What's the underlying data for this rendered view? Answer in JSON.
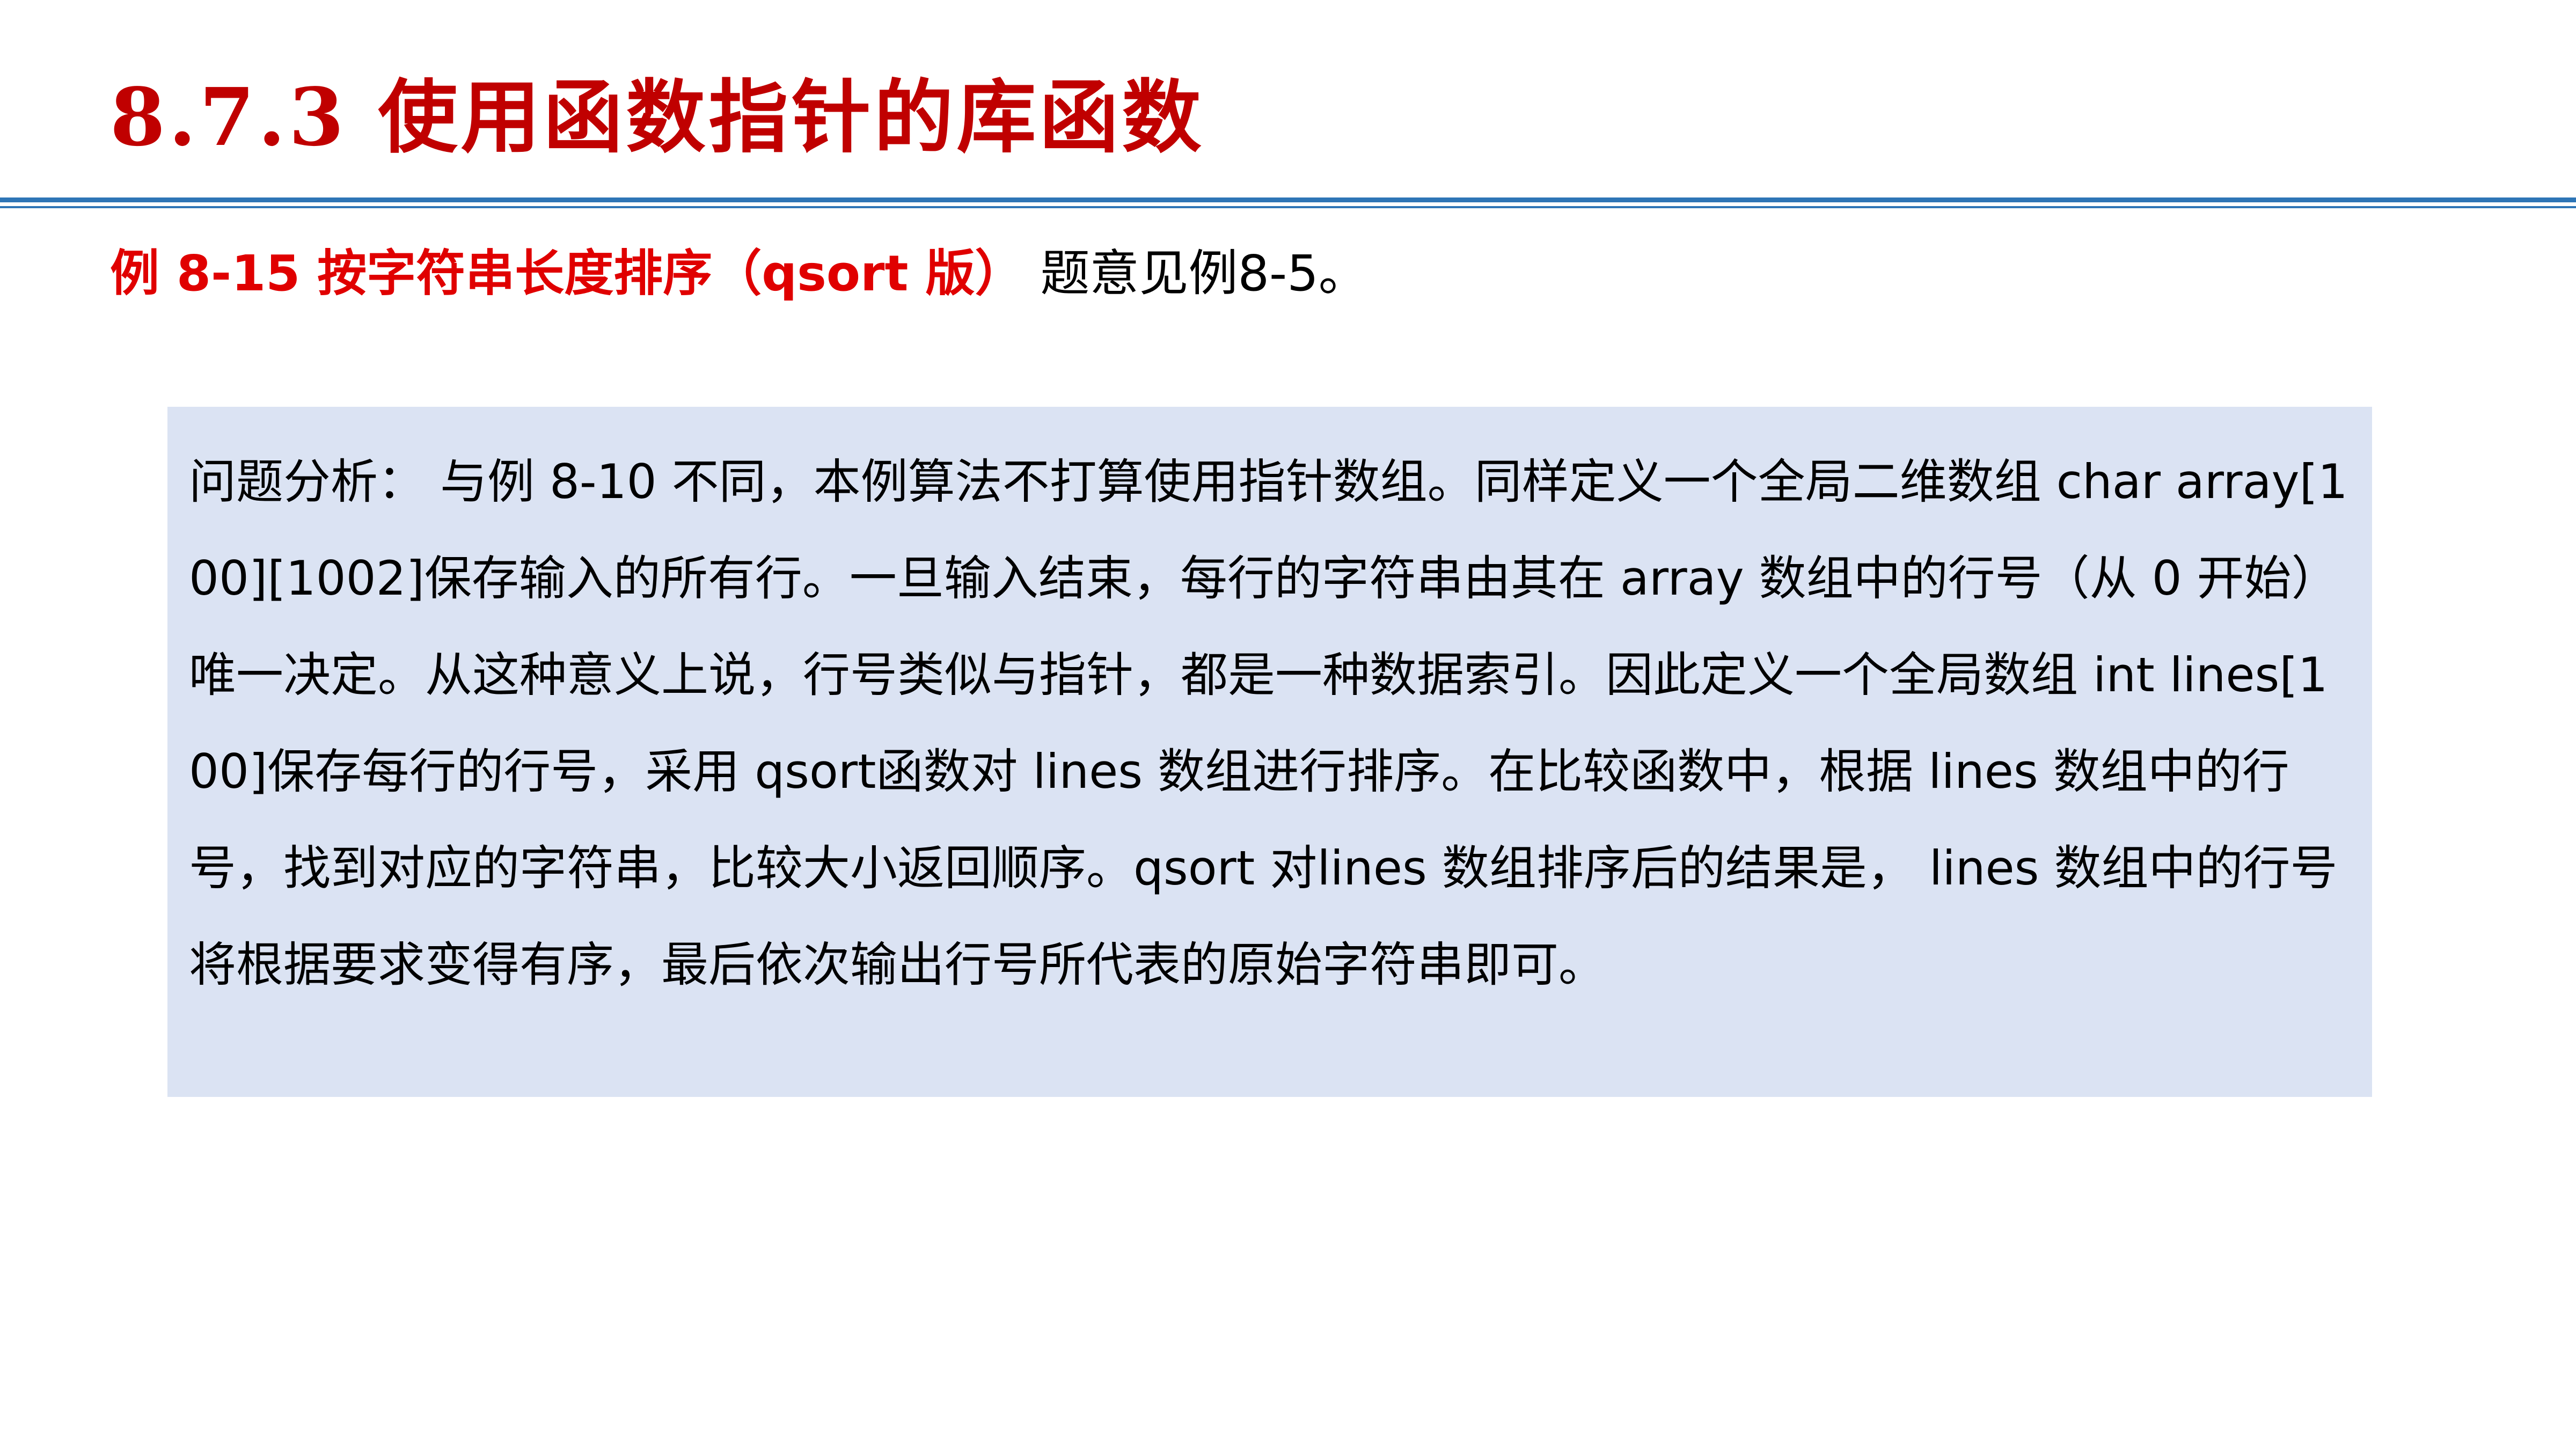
{
  "slide": {
    "title": "8.7.3 使用函数指针的库函数"
  },
  "example": {
    "heading": "例 8-15 按字符串长度排序（qsort 版）",
    "note": "题意见例8-5。"
  },
  "analysis": {
    "text": "问题分析： 与例 8-10 不同，本例算法不打算使用指针数组。同样定义一个全局二维数组 char array[100][1002]保存输入的所有行。一旦输入结束，每行的字符串由其在 array 数组中的行号（从 0 开始）唯一决定。从这种意义上说，行号类似与指针，都是一种数据索引。因此定义一个全局数组 int lines[100]保存每行的行号，采用 qsort函数对 lines 数组进行排序。在比较函数中，根据 lines 数组中的行号，找到对应的字符串，比较大小返回顺序。qsort 对lines 数组排序后的结果是， lines 数组中的行号将根据要求变得有序，最后依次输出行号所代表的原始字符串即可。"
  },
  "colors": {
    "title": "#c00000",
    "heading": "#e00000",
    "rule": "#2e75b6",
    "box_background": "#dbe3f3"
  }
}
